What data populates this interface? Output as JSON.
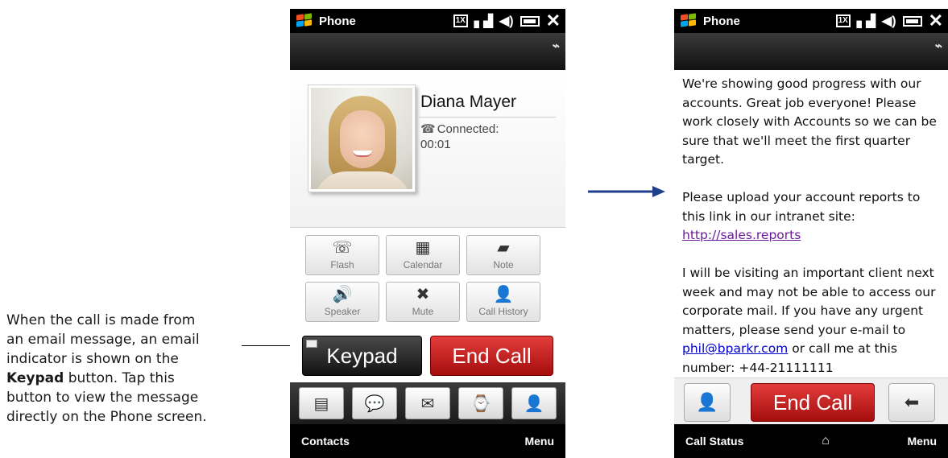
{
  "caption": {
    "line1": "When the call is made from",
    "line2": "an email message, an email",
    "line3": "indicator is shown on the",
    "line4_bold": "Keypad",
    "line4_rest": " button. Tap this",
    "line5": "button to view the message",
    "line6": "directly on the Phone screen."
  },
  "left_phone": {
    "status": {
      "title": "Phone",
      "network": "1X"
    },
    "contact": {
      "name": "Diana Mayer",
      "status_line1": "Connected:",
      "status_line2": "00:01"
    },
    "actions": [
      {
        "label": "Flash",
        "icon": "flash-icon",
        "glyph": "☏"
      },
      {
        "label": "Calendar",
        "icon": "calendar-icon",
        "glyph": "▦"
      },
      {
        "label": "Note",
        "icon": "note-icon",
        "glyph": "▰"
      },
      {
        "label": "Speaker",
        "icon": "speaker-icon",
        "glyph": "🔊"
      },
      {
        "label": "Mute",
        "icon": "mute-icon",
        "glyph": "✖"
      },
      {
        "label": "Call History",
        "icon": "call-history-icon",
        "glyph": "👤"
      }
    ],
    "keypad_label": "Keypad",
    "end_call_label": "End Call",
    "dock": [
      {
        "icon": "contact-card-icon",
        "glyph": "▤"
      },
      {
        "icon": "sms-icon",
        "glyph": "💬"
      },
      {
        "icon": "email-icon",
        "glyph": "✉"
      },
      {
        "icon": "call-log-icon",
        "glyph": "⌚"
      },
      {
        "icon": "contacts-icon",
        "glyph": "👤"
      }
    ],
    "softkeys": {
      "left": "Contacts",
      "right": "Menu"
    }
  },
  "right_phone": {
    "status": {
      "title": "Phone",
      "network": "1X"
    },
    "message": {
      "p1": "We're showing good progress with our accounts. Great job everyone! Please work closely with Accounts so we can be sure that we'll meet the first quarter target.",
      "p2_text": "Please upload your account reports to this link in our intranet site: ",
      "p2_link": "http://sales.reports",
      "p3_text": "I will be visiting an important client next week and may not be able to access our corporate mail. If you have any urgent matters, please send your e-mail to ",
      "p3_link": "phil@bparkr.com",
      "p3_rest": " or call me at this number: +44-21111111"
    },
    "end_call_label": "End Call",
    "softkeys": {
      "left": "Call Status",
      "right": "Menu"
    }
  },
  "colors": {
    "end_call_red": "#c41e1e",
    "arrow_blue": "#1f3f8c",
    "link_purple": "#6a1b9a",
    "link_blue": "#0000cc"
  }
}
